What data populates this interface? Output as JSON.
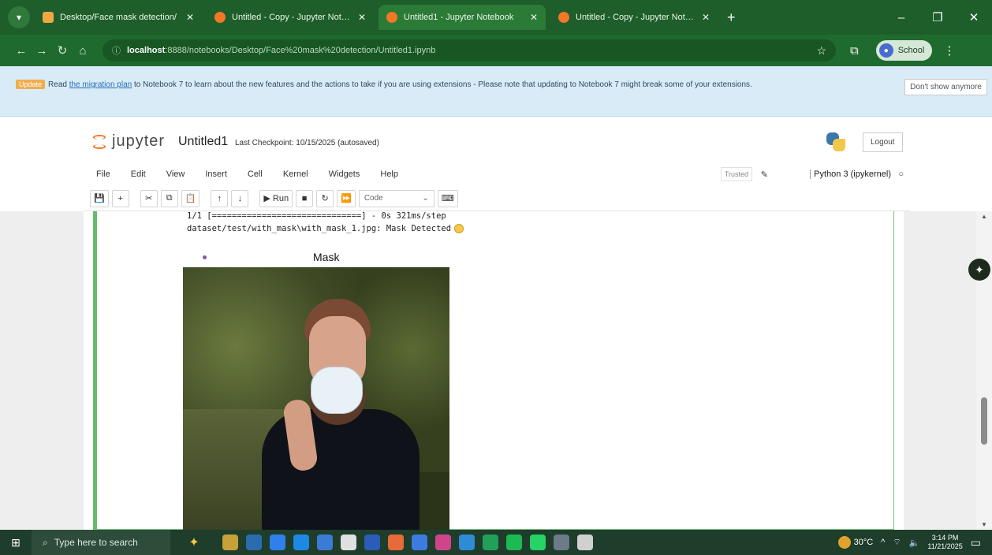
{
  "browser": {
    "tabs": [
      {
        "title": "Desktop/Face mask detection/",
        "favicon": "folder",
        "active": false
      },
      {
        "title": "Untitled - Copy - Jupyter Notebook",
        "favicon": "jupyter",
        "active": false
      },
      {
        "title": "Untitled1 - Jupyter Notebook",
        "favicon": "jupyter",
        "active": true
      },
      {
        "title": "Untitled - Copy - Jupyter Notebook",
        "favicon": "jupyter",
        "active": false
      }
    ],
    "url_host": "localhost",
    "url_path": ":8888/notebooks/Desktop/Face%20mask%20detection/Untitled1.ipynb",
    "profile_label": "School"
  },
  "banner": {
    "badge": "Update",
    "text_before": "Read ",
    "link": "the migration plan",
    "text_after": " to Notebook 7 to learn about the new features and the actions to take if you are using extensions - Please note that updating to Notebook 7 might break some of your extensions.",
    "dismiss": "Don't show anymore"
  },
  "header": {
    "logo_text": "jupyter",
    "notebook_name": "Untitled1",
    "checkpoint": "Last Checkpoint: 10/15/2025  (autosaved)",
    "logout": "Logout"
  },
  "menu": {
    "items": [
      "File",
      "Edit",
      "View",
      "Insert",
      "Cell",
      "Kernel",
      "Widgets",
      "Help"
    ],
    "trusted": "Trusted",
    "kernel": "Python 3 (ipykernel)"
  },
  "toolbar": {
    "run_label": "Run",
    "cell_type": "Code"
  },
  "output": {
    "progress_line": "1/1 [==============================] - 0s 321ms/step",
    "detect_line": "dataset/test/with_mask\\with_mask_1.jpg: Mask Detected",
    "plot_title": "Mask"
  },
  "taskbar": {
    "search_placeholder": "Type here to search",
    "temperature": "30°C",
    "time": "3:14 PM",
    "date": "11/21/2025",
    "icon_colors": [
      "#c9a13a",
      "#2b6cb0",
      "#2f80ed",
      "#1e88e5",
      "#3a7bd5",
      "#e0e0e0",
      "#2b5cb8",
      "#e66a3a",
      "#3e7be0",
      "#d0458a",
      "#2e8bd6",
      "#21a05a",
      "#1db954",
      "#25d366",
      "#6c7a89",
      "#d0d0d0"
    ]
  },
  "colors": {
    "browser_green": "#1e5e2a",
    "cell_border": "#66bb6a",
    "jupyter_orange": "#f37726"
  }
}
